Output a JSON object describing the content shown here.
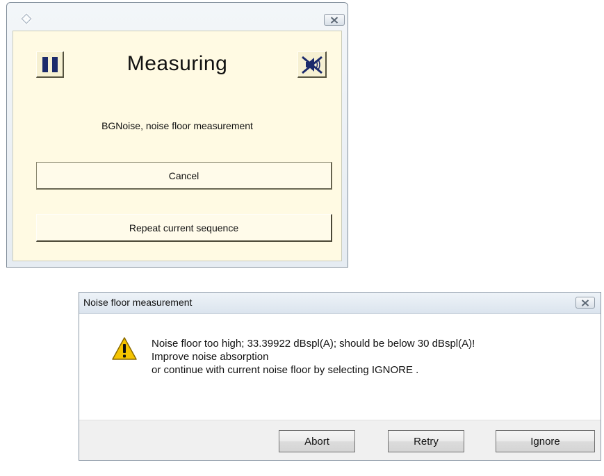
{
  "measuring_window": {
    "title": "Measuring",
    "status": "BGNoise, noise floor measurement",
    "cancel_label": "Cancel",
    "repeat_label": "Repeat current sequence",
    "icons": {
      "pause": "pause-icon",
      "mute": "speaker-mute-icon",
      "logo": "app-logo-icon",
      "close": "close-icon"
    }
  },
  "noise_dialog": {
    "title": "Noise floor measurement",
    "message_lines": [
      "Noise floor too high; 33.39922 dBspl(A); should be below 30 dBspl(A)!",
      "Improve noise absorption",
      "or continue with current noise floor by selecting IGNORE ."
    ],
    "buttons": {
      "abort": "Abort",
      "retry": "Retry",
      "ignore": "Ignore"
    },
    "icons": {
      "warning": "warning-icon",
      "close": "close-icon"
    }
  },
  "colors": {
    "client_background": "#fffae3",
    "pause_bars": "#1b2a6b",
    "warning_yellow": "#f5c400"
  }
}
